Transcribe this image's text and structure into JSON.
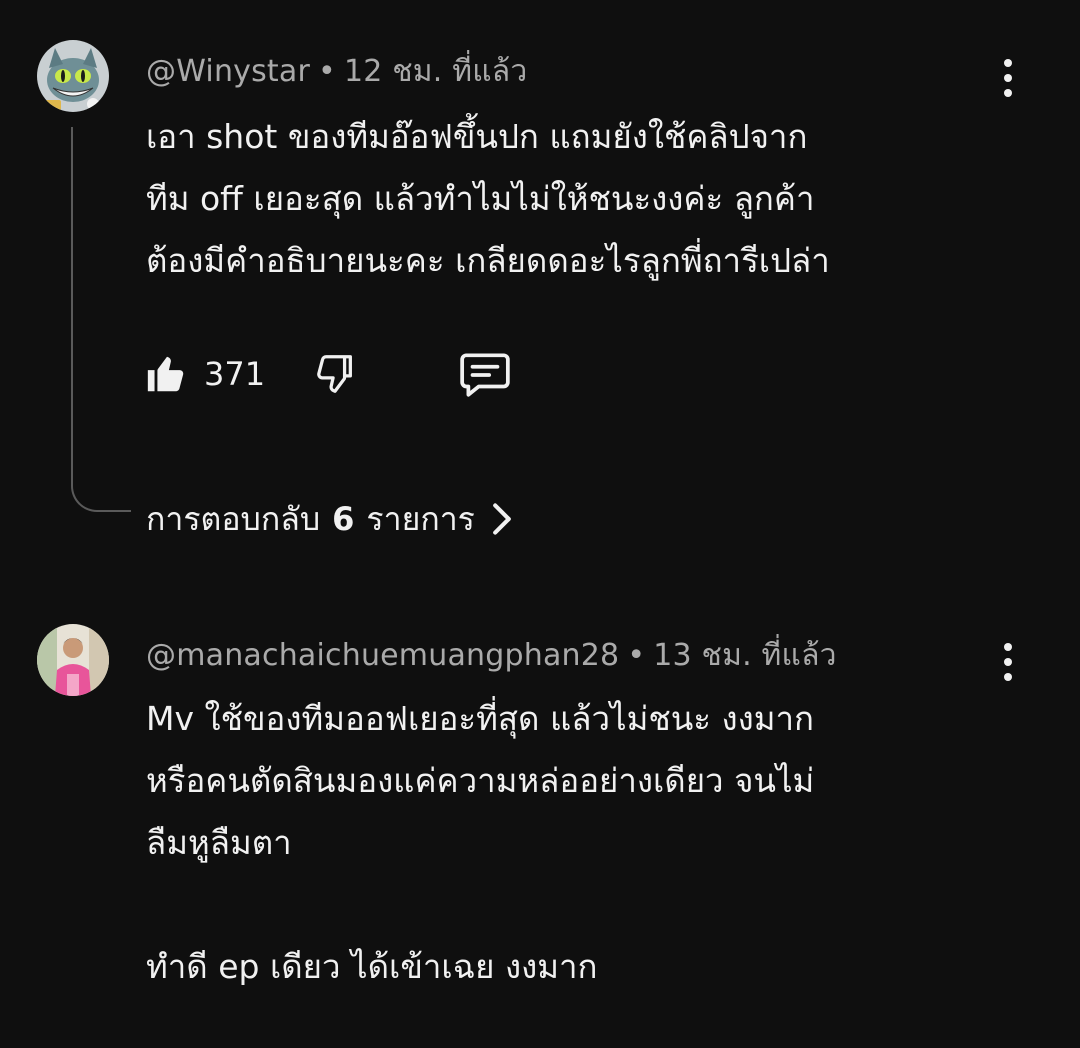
{
  "comments": [
    {
      "author": "@Winystar",
      "separator": "•",
      "time": "12 ชม. ที่แล้ว",
      "text": "เอา shot ของทีมอ๊อฟขึ้นปก แถมยังใช้คลิปจาก\nทีม off เยอะสุด แล้วทำไมไม่ให้ชนะงงค่ะ ลูกค้า\nต้องมีคำอธิบายนะคะ เกลียดดอะไรลูกพี่ถารีเปล่า",
      "likes": "371",
      "icons": {
        "avatar": "cheshire-cat-avatar",
        "like": "thumbs-up-icon",
        "dislike": "thumbs-down-icon",
        "reply": "comment-bubble-icon",
        "more": "more-vertical-icon"
      },
      "replies": {
        "prefix": "การตอบกลับ",
        "count": "6",
        "suffix": "รายการ"
      }
    },
    {
      "author": "@manachaichuemuangphan28",
      "separator": "•",
      "time": "13 ชม. ที่แล้ว",
      "text": "Mv ใช้ของทีมออฟเยอะที่สุด แล้วไม่ชนะ งงมาก\nหรือคนตัดสินมองแค่ความหล่ออย่างเดียว จนไม่\nลืมหูลืมตา\n\nทำดี ep เดียว ได้เข้าเฉย งงมาก",
      "icons": {
        "avatar": "person-avatar",
        "more": "more-vertical-icon"
      }
    }
  ],
  "colors": {
    "background": "#0f0f0f",
    "primary_text": "#f1f1f1",
    "secondary_text": "#aaaaaa",
    "thread_line": "#5a5a5a"
  }
}
